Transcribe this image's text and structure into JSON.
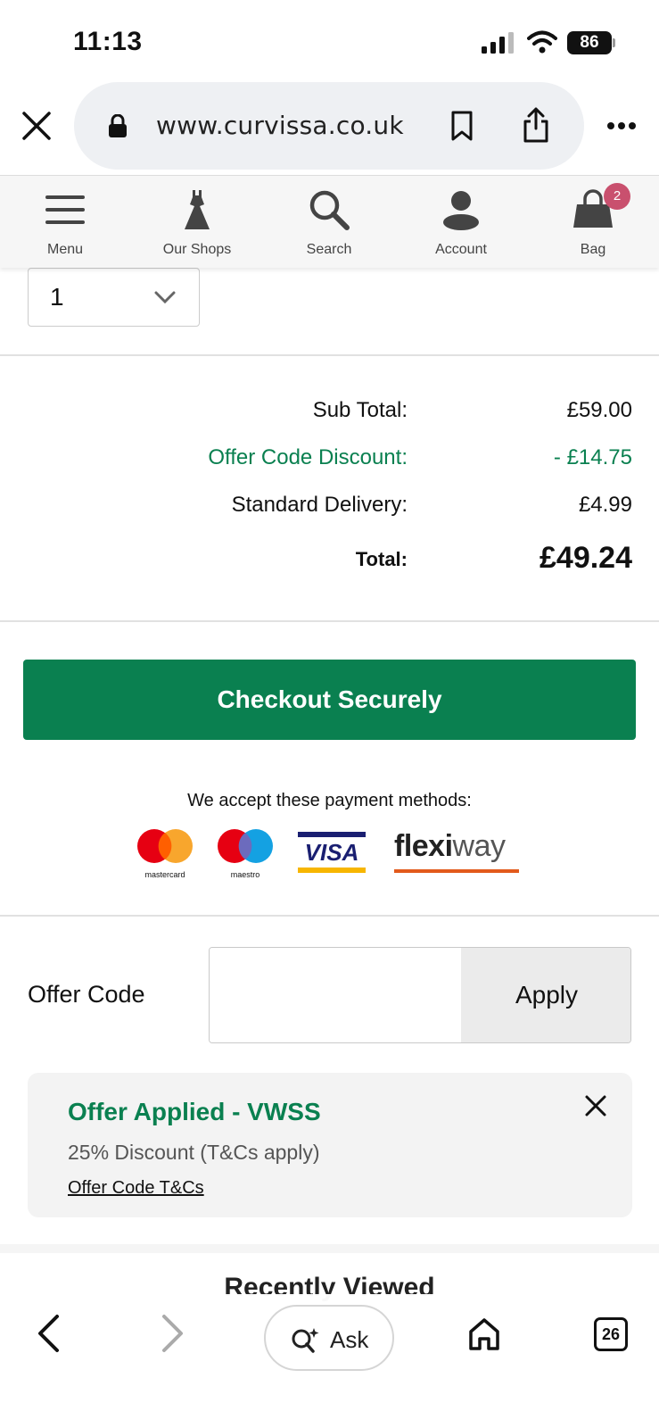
{
  "status_bar": {
    "time": "11:13",
    "battery": "86"
  },
  "browser": {
    "url": "www.curvissa.co.uk"
  },
  "site_nav": {
    "items": [
      {
        "label": "Menu",
        "icon": "hamburger-icon"
      },
      {
        "label": "Our Shops",
        "icon": "dress-icon"
      },
      {
        "label": "Search",
        "icon": "search-icon"
      },
      {
        "label": "Account",
        "icon": "account-icon"
      },
      {
        "label": "Bag",
        "icon": "bag-icon"
      }
    ],
    "bag_count": "2"
  },
  "quantity": {
    "value": "1"
  },
  "totals": {
    "subtotal_label": "Sub Total:",
    "subtotal_value": "£59.00",
    "discount_label": "Offer Code Discount:",
    "discount_value": "- £14.75",
    "delivery_label": "Standard Delivery:",
    "delivery_value": "£4.99",
    "total_label": "Total:",
    "total_value": "£49.24"
  },
  "checkout": {
    "button_label": "Checkout Securely",
    "payment_text": "We accept these payment methods:",
    "payment_methods": [
      {
        "name": "mastercard"
      },
      {
        "name": "maestro"
      },
      {
        "name": "VISA"
      },
      {
        "name": "flexiway",
        "parts": [
          "flexi",
          "way"
        ]
      }
    ]
  },
  "offer": {
    "label": "Offer Code",
    "input_value": "",
    "apply_label": "Apply",
    "applied_title": "Offer Applied - VWSS",
    "applied_desc": "25% Discount (T&Cs apply)",
    "terms_link": "Offer Code T&Cs"
  },
  "recently_viewed": {
    "heading": "Recently Viewed"
  },
  "toolbar": {
    "ask_label": "Ask",
    "tab_count": "26"
  },
  "colors": {
    "brand_green": "#0a8050",
    "badge_pink": "#c9506e"
  }
}
